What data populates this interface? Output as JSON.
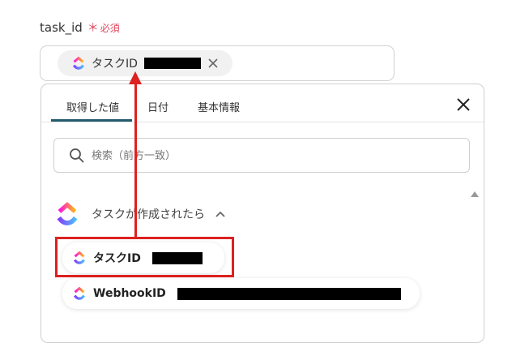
{
  "field": {
    "label": "task_id",
    "required_mark": "＊",
    "required_text": "必須"
  },
  "selected_chip": {
    "label": "タスクID",
    "icon": "clickup-logo-icon",
    "remove_icon": "close-icon"
  },
  "popup": {
    "tabs": [
      "取得した値",
      "日付",
      "基本情報"
    ],
    "active_tab": "取得した値",
    "close_icon": "close-icon",
    "search": {
      "placeholder": "検索（前方一致）",
      "value": ""
    },
    "section": {
      "title": "タスクが作成されたら",
      "icon": "clickup-logo-icon",
      "expanded": true
    },
    "items": [
      {
        "label": "タスクID",
        "icon": "clickup-logo-icon"
      },
      {
        "label": "WebhookID",
        "icon": "clickup-logo-icon"
      }
    ]
  },
  "annotation": {
    "color": "#dd2020"
  },
  "colors": {
    "accent": "#235b70",
    "required": "#e0455a"
  }
}
